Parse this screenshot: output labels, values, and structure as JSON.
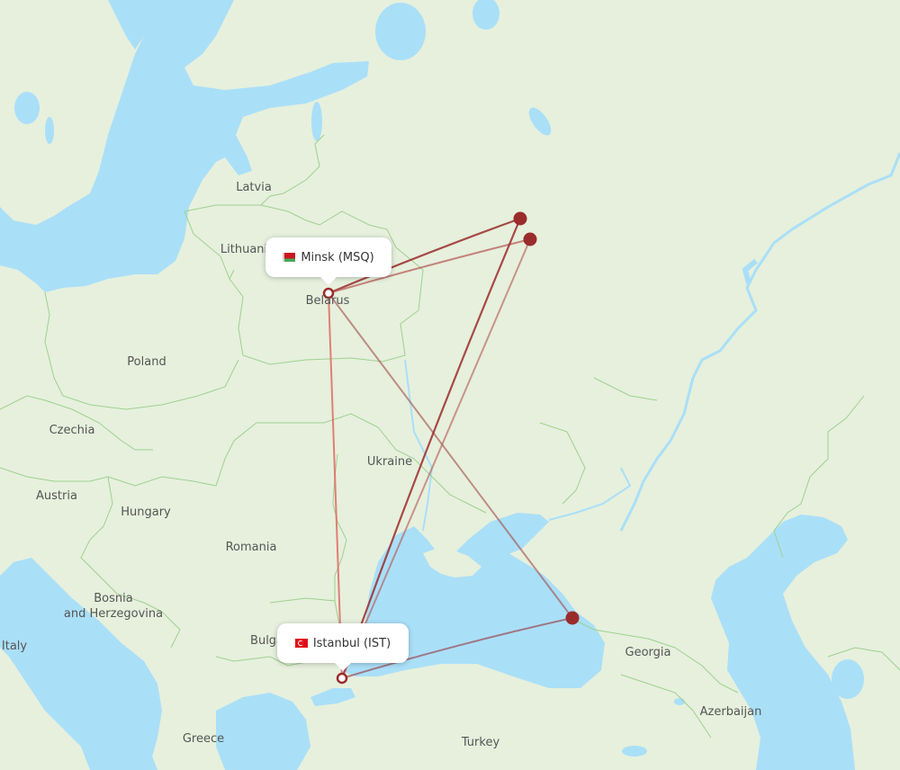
{
  "map": {
    "colors": {
      "land": "#e6f0dd",
      "land_dark": "#dbe9cf",
      "water": "#aadff8",
      "border": "#9fd08f",
      "route": "#9b2c2c",
      "route_light": "#e0605a",
      "airport_dot": "#9b2c2c"
    },
    "country_labels": [
      {
        "name": "Latvia"
      },
      {
        "name": "Lithuania"
      },
      {
        "name": "Belarus"
      },
      {
        "name": "Poland"
      },
      {
        "name": "Czechia"
      },
      {
        "name": "Austria"
      },
      {
        "name": "Hungary"
      },
      {
        "name": "Ukraine"
      },
      {
        "name": "Romania"
      },
      {
        "name": "Bosnia"
      },
      {
        "name": "and Herzegovina"
      },
      {
        "name": "Italy"
      },
      {
        "name": "Bulgaria"
      },
      {
        "name": "Greece"
      },
      {
        "name": "Turkey"
      },
      {
        "name": "Georgia"
      },
      {
        "name": "Azerbaijan"
      }
    ],
    "airports": [
      {
        "id": "MSQ",
        "label": "Minsk (MSQ)",
        "flag": "belarus-flag",
        "selected": true
      },
      {
        "id": "IST",
        "label": "Istanbul (IST)",
        "flag": "turkey-flag",
        "selected": true
      },
      {
        "id": "moscow-1",
        "label": "",
        "selected": false
      },
      {
        "id": "moscow-2",
        "label": "",
        "selected": false
      },
      {
        "id": "sochi",
        "label": "",
        "selected": false
      }
    ],
    "routes": [
      {
        "from": "MSQ",
        "to": "IST",
        "style": "light"
      },
      {
        "from": "MSQ",
        "to": "moscow-1",
        "style": "dark"
      },
      {
        "from": "MSQ",
        "to": "moscow-2",
        "style": "medium"
      },
      {
        "from": "MSQ",
        "to": "sochi",
        "style": "medium"
      },
      {
        "from": "IST",
        "to": "moscow-1",
        "style": "dark"
      },
      {
        "from": "IST",
        "to": "moscow-2",
        "style": "medium"
      },
      {
        "from": "IST",
        "to": "sochi",
        "style": "medium"
      }
    ]
  }
}
